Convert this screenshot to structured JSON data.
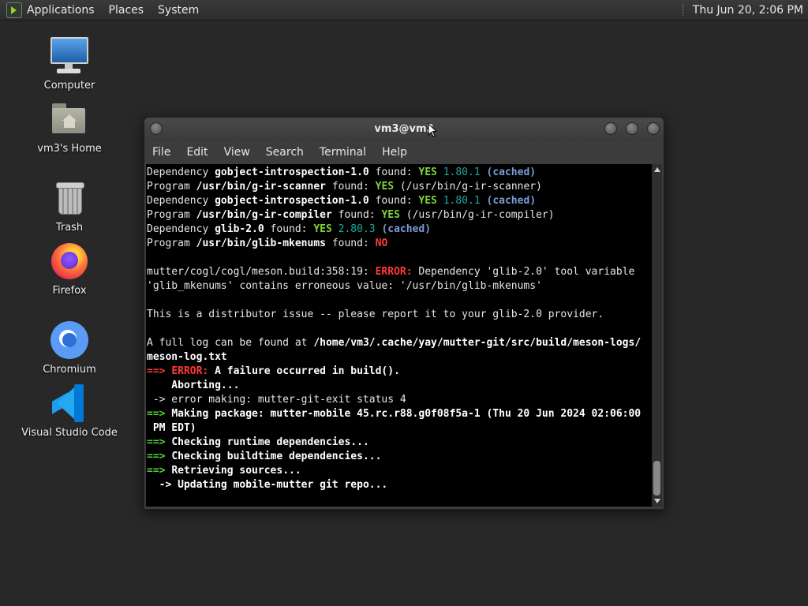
{
  "panel": {
    "menus": [
      "Applications",
      "Places",
      "System"
    ],
    "clock": "Thu Jun 20,  2:06 PM"
  },
  "desktop_icons": [
    {
      "label": "Computer",
      "icon": "computer-icon"
    },
    {
      "label": "vm3's Home",
      "icon": "home-folder-icon"
    },
    {
      "label": "Trash",
      "icon": "trash-icon"
    },
    {
      "label": "Firefox",
      "icon": "firefox-icon"
    },
    {
      "label": "Chromium",
      "icon": "chromium-icon"
    },
    {
      "label": "Visual Studio Code",
      "icon": "vscode-icon"
    }
  ],
  "terminal": {
    "title": "vm3@vm3",
    "menu": [
      "File",
      "Edit",
      "View",
      "Search",
      "Terminal",
      "Help"
    ],
    "lines": [
      [
        {
          "t": "Dependency "
        },
        {
          "t": "gobject-introspection-1.0",
          "s": "b"
        },
        {
          "t": " found: "
        },
        {
          "t": "YES",
          "s": "y"
        },
        {
          "t": " "
        },
        {
          "t": "1.80.1",
          "s": "d"
        },
        {
          "t": " "
        },
        {
          "t": "(cached)",
          "s": "c"
        }
      ],
      [
        {
          "t": "Program "
        },
        {
          "t": "/usr/bin/g-ir-scanner",
          "s": "b"
        },
        {
          "t": " found: "
        },
        {
          "t": "YES",
          "s": "y"
        },
        {
          "t": " (/usr/bin/g-ir-scanner)"
        }
      ],
      [
        {
          "t": "Dependency "
        },
        {
          "t": "gobject-introspection-1.0",
          "s": "b"
        },
        {
          "t": " found: "
        },
        {
          "t": "YES",
          "s": "y"
        },
        {
          "t": " "
        },
        {
          "t": "1.80.1",
          "s": "d"
        },
        {
          "t": " "
        },
        {
          "t": "(cached)",
          "s": "c"
        }
      ],
      [
        {
          "t": "Program "
        },
        {
          "t": "/usr/bin/g-ir-compiler",
          "s": "b"
        },
        {
          "t": " found: "
        },
        {
          "t": "YES",
          "s": "y"
        },
        {
          "t": " (/usr/bin/g-ir-compiler)"
        }
      ],
      [
        {
          "t": "Dependency "
        },
        {
          "t": "glib-2.0",
          "s": "b"
        },
        {
          "t": " found: "
        },
        {
          "t": "YES",
          "s": "y"
        },
        {
          "t": " "
        },
        {
          "t": "2.80.3",
          "s": "d"
        },
        {
          "t": " "
        },
        {
          "t": "(cached)",
          "s": "c"
        }
      ],
      [
        {
          "t": "Program "
        },
        {
          "t": "/usr/bin/glib-mkenums",
          "s": "b"
        },
        {
          "t": " found: "
        },
        {
          "t": "NO",
          "s": "r"
        }
      ],
      [],
      [
        {
          "t": "mutter/cogl/cogl/meson.build:358:19: "
        },
        {
          "t": "ERROR:",
          "s": "r"
        },
        {
          "t": " Dependency 'glib-2.0' tool variable"
        }
      ],
      [
        {
          "t": "'glib_mkenums' contains erroneous value: '/usr/bin/glib-mkenums'"
        }
      ],
      [],
      [
        {
          "t": "This is a distributor issue -- please report it to your glib-2.0 provider."
        }
      ],
      [],
      [
        {
          "t": "A full log can be found at "
        },
        {
          "t": "/home/vm3/.cache/yay/mutter-git/src/build/meson-logs/",
          "s": "b"
        }
      ],
      [
        {
          "t": "meson-log.txt",
          "s": "b"
        }
      ],
      [
        {
          "t": "==> ",
          "s": "r"
        },
        {
          "t": "ERROR:",
          "s": "r"
        },
        {
          "t": " A failure occurred in build().",
          "s": "b"
        }
      ],
      [
        {
          "t": "    Aborting...",
          "s": "b"
        }
      ],
      [
        {
          "t": " -> error making: mutter-git-exit status 4"
        }
      ],
      [
        {
          "t": "==> ",
          "s": "g"
        },
        {
          "t": "Making package: mutter-mobile 45.rc.r88.g0f08f5a-1 (Thu 20 Jun 2024 02:06:00",
          "s": "b"
        }
      ],
      [
        {
          "t": " PM EDT)",
          "s": "b"
        }
      ],
      [
        {
          "t": "==> ",
          "s": "g"
        },
        {
          "t": "Checking runtime dependencies...",
          "s": "b"
        }
      ],
      [
        {
          "t": "==> ",
          "s": "g"
        },
        {
          "t": "Checking buildtime dependencies...",
          "s": "b"
        }
      ],
      [
        {
          "t": "==> ",
          "s": "g"
        },
        {
          "t": "Retrieving sources...",
          "s": "b"
        }
      ],
      [
        {
          "t": "  -> ",
          "s": "b"
        },
        {
          "t": "Updating mobile-mutter git repo...",
          "s": "b"
        }
      ]
    ]
  }
}
